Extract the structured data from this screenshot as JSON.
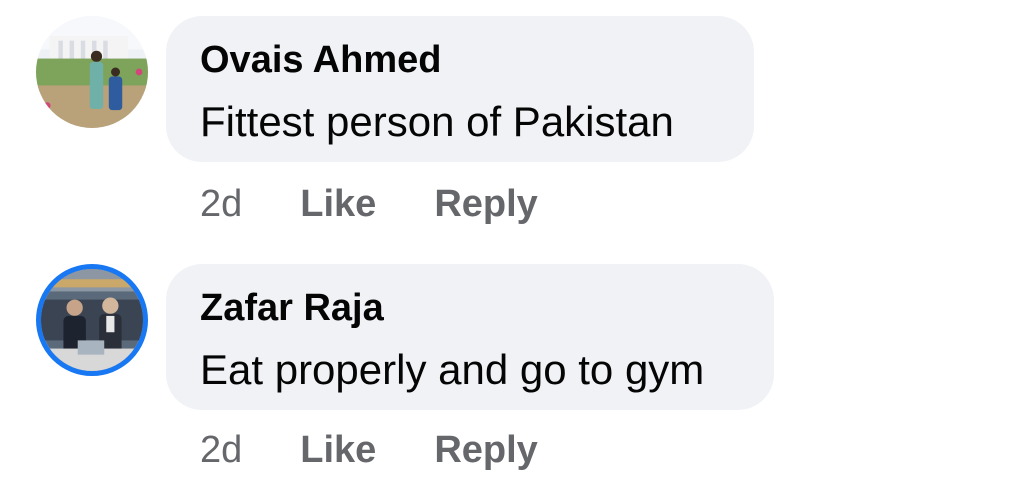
{
  "comments": [
    {
      "author": "Ovais Ahmed",
      "text": "Fittest person of Pakistan",
      "time": "2d",
      "like_label": "Like",
      "reply_label": "Reply"
    },
    {
      "author": "Zafar Raja",
      "text": "Eat properly and go to gym",
      "time": "2d",
      "like_label": "Like",
      "reply_label": "Reply"
    }
  ],
  "colors": {
    "bubble_bg": "#f0f2f5",
    "text": "#050505",
    "meta": "#65676b",
    "story_ring": "#1877f2"
  }
}
